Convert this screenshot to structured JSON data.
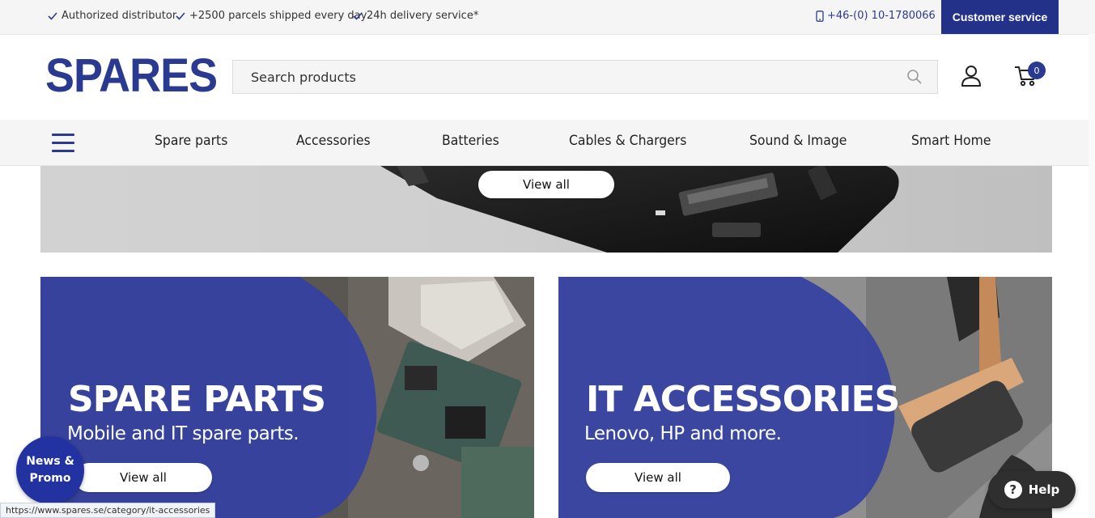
{
  "topbar": {
    "usps": [
      "Authorized distributor",
      "+2500 parcels shipped every day",
      "24h delivery service*"
    ],
    "phone": "+46-(0) 10-1780066",
    "customer_service": "Customer service"
  },
  "header": {
    "logo": "SPARES",
    "search_placeholder": "Search products",
    "cart_count": "0"
  },
  "nav": {
    "items": [
      "Spare parts",
      "Accessories",
      "Batteries",
      "Cables & Chargers",
      "Sound & Image",
      "Smart Home"
    ]
  },
  "hero": {
    "button": "View all"
  },
  "cards": [
    {
      "title": "SPARE PARTS",
      "subtitle": "Mobile and IT spare parts.",
      "button": "View all"
    },
    {
      "title": "IT ACCESSORIES",
      "subtitle": "Lenovo, HP and more.",
      "button": "View all"
    }
  ],
  "widgets": {
    "news_line1": "News &",
    "news_line2": "Promo",
    "help": "Help",
    "status_url": "https://www.spares.se/category/it-accessories"
  },
  "colors": {
    "brand": "#2b3a91",
    "overlay": "#3441a0"
  }
}
